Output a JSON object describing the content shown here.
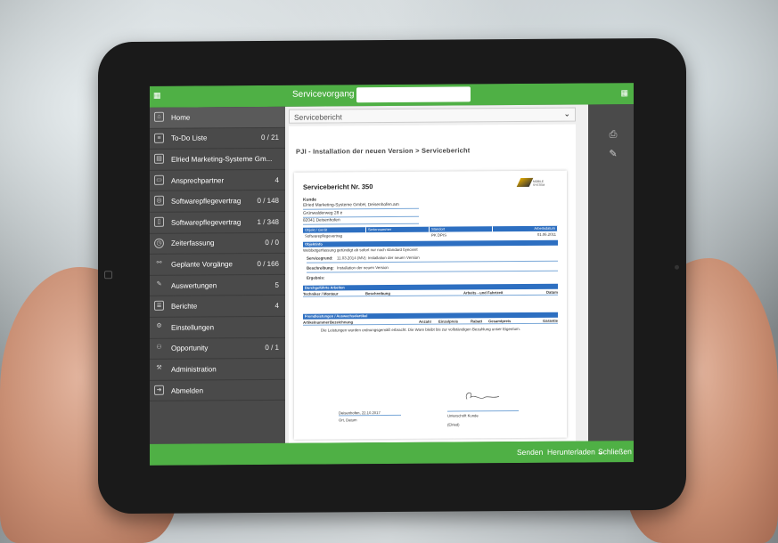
{
  "topbar": {
    "context_label": "Servicevorgang",
    "search_value": ""
  },
  "sidebar": {
    "items": [
      {
        "label": "Home",
        "count": ""
      },
      {
        "label": "To-Do Liste",
        "count": "0 / 21"
      },
      {
        "label": "Elried Marketing-Systeme Gm...",
        "count": ""
      },
      {
        "label": "Ansprechpartner",
        "count": "4"
      },
      {
        "label": "Softwarepflegevertrag",
        "count": "0 / 148"
      },
      {
        "label": "Softwarepflegevertrag",
        "count": "1 / 348"
      },
      {
        "label": "Zeiterfassung",
        "count": "0 / 0"
      },
      {
        "label": "Geplante Vorgänge",
        "count": "0 / 166"
      },
      {
        "label": "Auswertungen",
        "count": "5"
      },
      {
        "label": "Berichte",
        "count": "4"
      },
      {
        "label": "Einstellungen",
        "count": ""
      },
      {
        "label": "Opportunity",
        "count": "0 / 1"
      },
      {
        "label": "Administration",
        "count": ""
      },
      {
        "label": "Abmelden",
        "count": ""
      }
    ]
  },
  "main": {
    "dropdown_value": "Servicebericht",
    "page_title": "PJI - Installation der neuen Version > Servicebericht"
  },
  "report": {
    "title": "Servicebericht Nr. 350",
    "kunde_label": "Kunde",
    "kunde_lines": [
      "Elried Marketing-Systeme GmbH, Deisenhofen.am",
      "Grünwalderweg 28 e",
      "82041 Deisenhofen"
    ],
    "table_headers": [
      "Objekt / Gerät",
      "Seriennummer",
      "Standort",
      "Arbeitsdatum"
    ],
    "table_row": [
      "Softwarepflegevertrag",
      "",
      "PK DPIS",
      "01.06.2011"
    ],
    "objectinfo_header": "Objektinfo",
    "objectinfo_text": "Webbetgerfassung getündigt ab sofort nur noch standard byecient",
    "fields": [
      {
        "label": "Servicegrund:",
        "value": "11.03.2014 (MV): Installation der neuen Version"
      },
      {
        "label": "Beschreibung:",
        "value": "Installation der neuen Version"
      },
      {
        "label": "Ergebnis:",
        "value": ""
      }
    ],
    "work_header": "Durchgeführte Arbeiten",
    "work_cols": [
      "Techniker / Monteur",
      "Beschreibung",
      "Arbeits - und Fahrtzeit",
      "Datum"
    ],
    "material_header": "Fremdleistungen / Auswechselartikel",
    "material_cols": [
      "Artikelnummer",
      "Bezeichnung",
      "Anzahl",
      "Einzelpreis",
      "Rabatt",
      "Gesamtpreis",
      "Garantie"
    ],
    "confirm_text": "Die Leistungen wurden ordnungsgemäß erbracht. Die Ware bleibt bis zur vollständigen Bezahlung unser Eigentum.",
    "sig_left_value": "Deisenhofen, 22.10.2017",
    "sig_left_label": "Ort, Datum",
    "sig_right_label": "Unterschrift Kunde",
    "sig_right_name": "(Elried)",
    "logo_text": "MOBILE SYSTEM"
  },
  "bottombar": {
    "send": "Senden",
    "download": "Herunterladen",
    "close": "Schließen"
  },
  "colors": {
    "accent": "#4fb045",
    "sidebar": "#4a4a4a",
    "report_blue": "#2d6fc1"
  }
}
